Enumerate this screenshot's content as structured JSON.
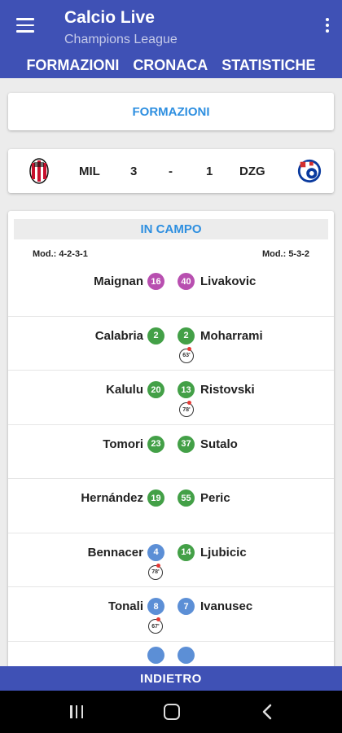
{
  "app": {
    "title": "Calcio Live",
    "subtitle": "Champions League"
  },
  "tabs": [
    "FORMAZIONI",
    "CRONACA",
    "STATISTICHE"
  ],
  "formazioni_title": "FORMAZIONI",
  "score": {
    "home": "MIL",
    "home_goals": "3",
    "separator": "-",
    "away_goals": "1",
    "away": "DZG"
  },
  "lineup": {
    "title": "IN CAMPO",
    "home_module": "Mod.: 4-2-3-1",
    "away_module": "Mod.: 5-3-2"
  },
  "rows": [
    {
      "home": "Maignan",
      "home_num": "16",
      "home_color": "#b84fb0",
      "away": "Livakovic",
      "away_num": "40",
      "away_color": "#b84fb0",
      "home_sub": "",
      "away_sub": ""
    },
    {
      "home": "Calabria",
      "home_num": "2",
      "home_color": "#43a047",
      "away": "Moharrami",
      "away_num": "2",
      "away_color": "#43a047",
      "home_sub": "",
      "away_sub": "63'"
    },
    {
      "home": "Kalulu",
      "home_num": "20",
      "home_color": "#43a047",
      "away": "Ristovski",
      "away_num": "13",
      "away_color": "#43a047",
      "home_sub": "",
      "away_sub": "78'"
    },
    {
      "home": "Tomori",
      "home_num": "23",
      "home_color": "#43a047",
      "away": "Sutalo",
      "away_num": "37",
      "away_color": "#43a047",
      "home_sub": "",
      "away_sub": ""
    },
    {
      "home": "Hernández",
      "home_num": "19",
      "home_color": "#43a047",
      "away": "Peric",
      "away_num": "55",
      "away_color": "#43a047",
      "home_sub": "",
      "away_sub": ""
    },
    {
      "home": "Bennacer",
      "home_num": "4",
      "home_color": "#5c8fd6",
      "away": "Ljubicic",
      "away_num": "14",
      "away_color": "#43a047",
      "home_sub": "78'",
      "away_sub": ""
    },
    {
      "home": "Tonali",
      "home_num": "8",
      "home_color": "#5c8fd6",
      "away": "Ivanusec",
      "away_num": "7",
      "away_color": "#5c8fd6",
      "home_sub": "67'",
      "away_sub": ""
    },
    {
      "home": "",
      "home_num": "",
      "home_color": "#5c8fd6",
      "away": "",
      "away_num": "",
      "away_color": "#5c8fd6",
      "home_sub": "",
      "away_sub": ""
    }
  ],
  "bottom_button": "INDIETRO"
}
